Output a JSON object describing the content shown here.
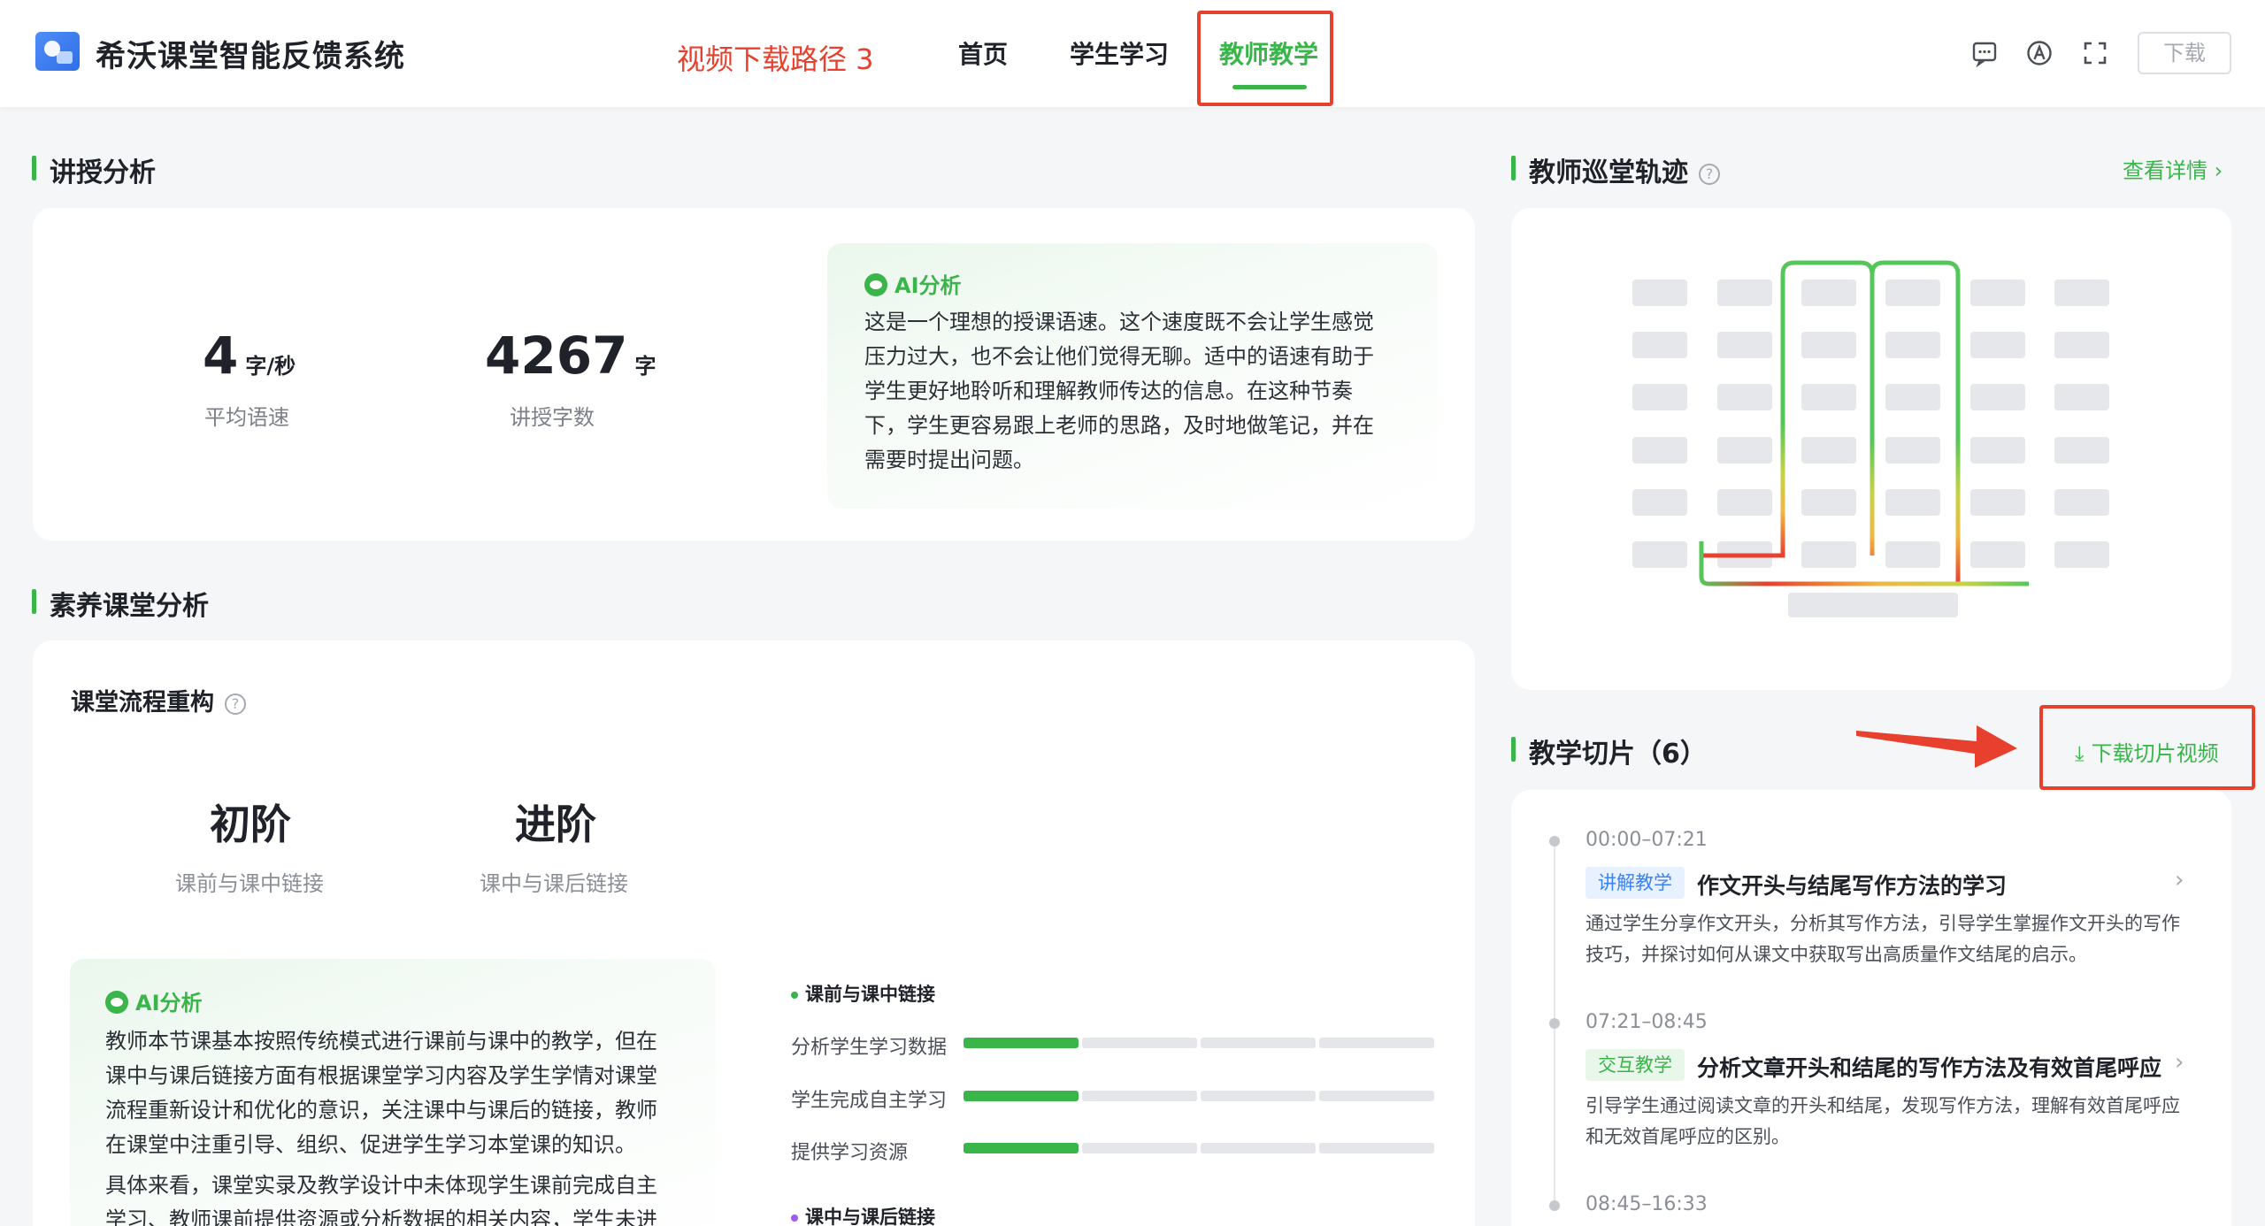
{
  "header": {
    "title": "希沃课堂智能反馈系统",
    "annotation": "视频下载路径 3",
    "nav": [
      "首页",
      "学生学习",
      "教师教学"
    ],
    "active_nav": "教师教学",
    "download_label": "下载",
    "icons": [
      "message-icon",
      "accessibility-icon",
      "fullscreen-icon"
    ]
  },
  "lecture": {
    "title": "讲授分析",
    "speed_value": "4",
    "speed_unit": "字/秒",
    "speed_label": "平均语速",
    "words_value": "4267",
    "words_unit": "字",
    "words_label": "讲授字数",
    "ai_tag": "AI分析",
    "ai_lines": [
      "这是一个理想的授课语速。这个速度既不会让学生感觉",
      "压力过大，也不会让他们觉得无聊。适中的语速有助于",
      "学生更好地聆听和理解教师传达的信息。在这种节奏",
      "下，学生更容易跟上老师的思路，及时地做笔记，并在",
      "需要时提出问题。"
    ]
  },
  "quality": {
    "title": "素养课堂分析",
    "subtitle": "课堂流程重构",
    "level1": "初阶",
    "level1_desc": "课前与课中链接",
    "level2": "进阶",
    "level2_desc": "课中与课后链接",
    "ai_tag": "AI分析",
    "ai_lines": [
      "教师本节课基本按照传统模式进行课前与课中的教学，但在",
      "课中与课后链接方面有根据课堂学习内容及学生学情对课堂",
      "流程重新设计和优化的意识，关注课中与课后的链接，教师",
      "在课堂中注重引导、组织、促进学生学习本堂课的知识。",
      "具体来看，课堂实录及教学设计中未体现学生课前完成自主",
      "学习、教师课前提供资源或分析数据的相关内容，学生未进"
    ],
    "group1": "课前与课中链接",
    "bars": [
      {
        "label": "分析学生学习数据",
        "level": 1,
        "total": 4
      },
      {
        "label": "学生完成自主学习",
        "level": 1,
        "total": 4
      },
      {
        "label": "提供学习资源",
        "level": 1,
        "total": 4
      }
    ],
    "group2": "课中与课后链接"
  },
  "patrol": {
    "title": "教师巡堂轨迹",
    "details_link": "查看详情 ›"
  },
  "slices": {
    "title": "教学切片（6）",
    "download_label": "下载切片视频",
    "items": [
      {
        "time": "00:00–07:21",
        "tag": "讲解教学",
        "name": "作文开头与结尾写作方法的学习",
        "desc": [
          "通过学生分享作文开头，分析其写作方法，引导学生掌握作文开头的写作",
          "技巧，并探讨如何从课文中获取写出高质量作文结尾的启示。"
        ]
      },
      {
        "time": "07:21–08:45",
        "tag": "交互教学",
        "name": "分析文章开头和结尾的写作方法及有效首尾呼应",
        "desc": [
          "引导学生通过阅读文章的开头和结尾，发现写作方法，理解有效首尾呼应",
          "和无效首尾呼应的区别。"
        ]
      },
      {
        "time": "08:45–16:33"
      }
    ]
  },
  "colors": {
    "accent": "#39b54a",
    "annotation": "#e8402e",
    "trail_low": "#e8402e",
    "trail_mid": "#f5c242",
    "trail_high": "#55c75a"
  }
}
